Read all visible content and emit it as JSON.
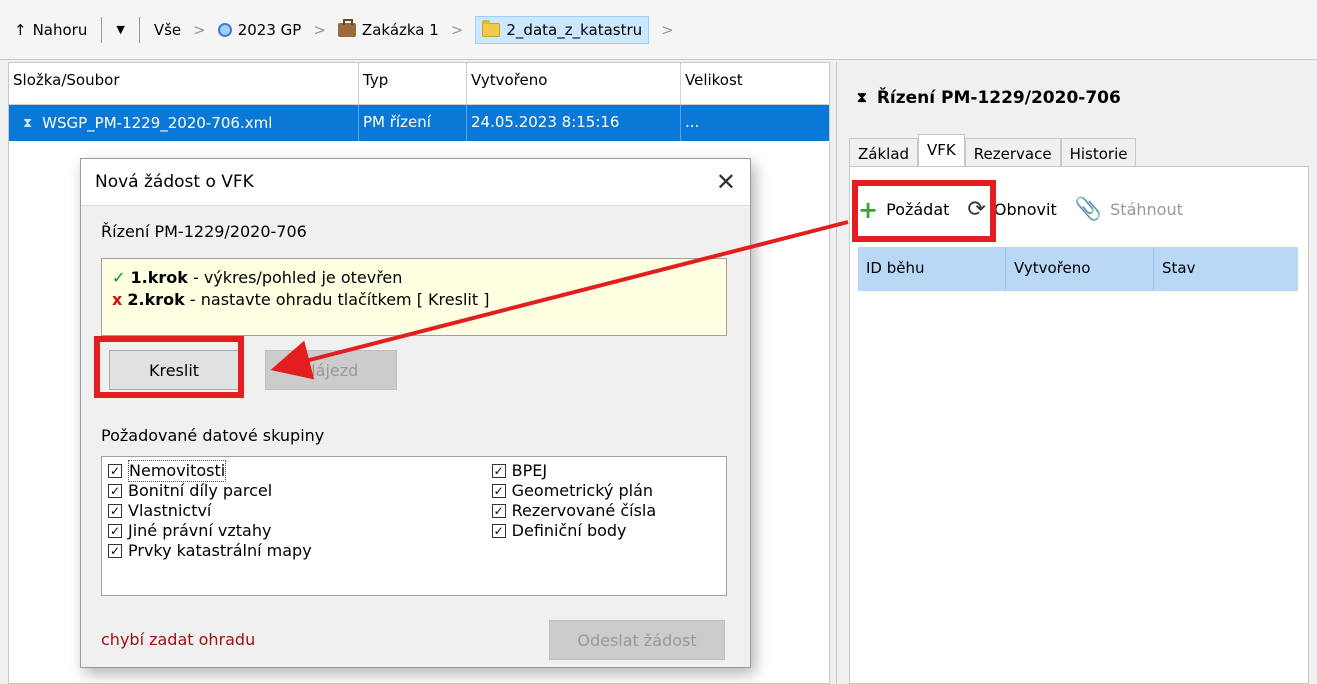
{
  "toolbar": {
    "up_label": "Nahoru",
    "crumbs": [
      "Vše",
      "2023 GP",
      "Zakázka 1",
      "2_data_z_katastru"
    ]
  },
  "table": {
    "headers": [
      "Složka/Soubor",
      "Typ",
      "Vytvořeno",
      "Velikost"
    ],
    "row": {
      "name": "WSGP_PM-1229_2020-706.xml",
      "type": "PM řízení",
      "created": "24.05.2023 8:15:16",
      "size": "..."
    }
  },
  "right_panel": {
    "title": "Řízení PM-1229/2020-706",
    "tabs": [
      "Základ",
      "VFK",
      "Rezervace",
      "Historie"
    ],
    "actions": {
      "request": "Požádat",
      "refresh": "Obnovit",
      "download": "Stáhnout"
    },
    "grid_headers": [
      "ID běhu",
      "Vytvořeno",
      "Stav"
    ]
  },
  "dialog": {
    "title": "Nová žádost o VFK",
    "subtitle": "Řízení PM-1229/2020-706",
    "step1": {
      "mark": "✓",
      "label": "1.krok",
      "text": " - výkres/pohled je otevřen"
    },
    "step2": {
      "mark": "x",
      "label": "2.krok",
      "text": " - nastavte ohradu tlačítkem [ Kreslit ]"
    },
    "draw_button": "Kreslit",
    "zoom_button": "Nájezd",
    "groups_label": "Požadované datové skupiny",
    "groups_left": [
      "Nemovitosti",
      "Bonitní díly parcel",
      "Vlastnictví",
      "Jiné právní vztahy",
      "Prvky katastrální mapy"
    ],
    "groups_right": [
      "BPEJ",
      "Geometrický plán",
      "Rezervované čísla",
      "Definiční body"
    ],
    "warning": "chybí zadat ohradu",
    "send_button": "Odeslat žádost"
  },
  "colors": {
    "accent": "#0a78d7",
    "highlight": "#e41e1e"
  }
}
